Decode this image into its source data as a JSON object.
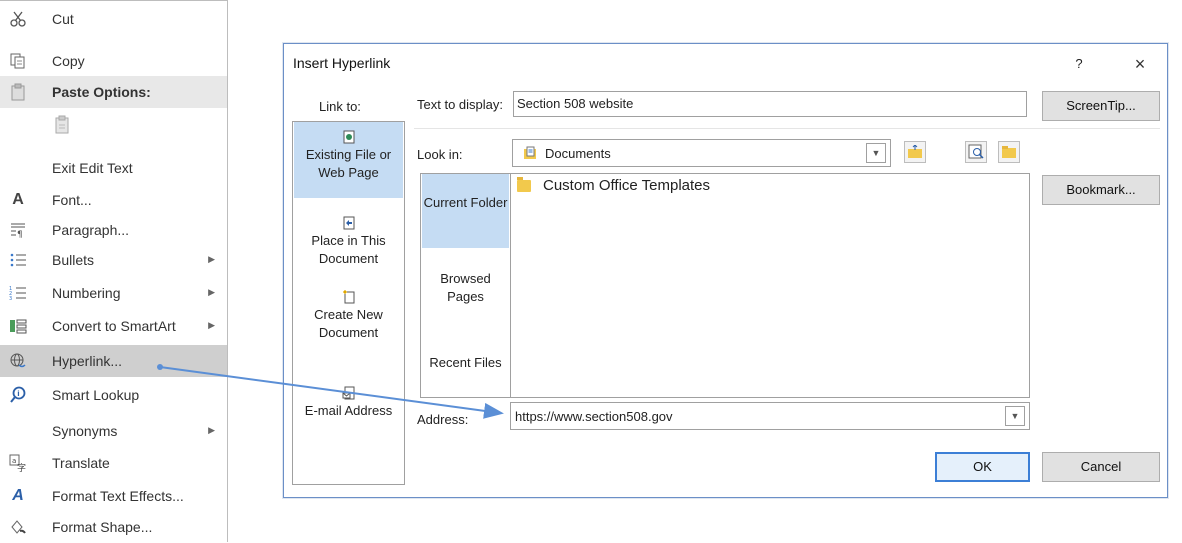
{
  "context_menu": {
    "cut": "Cut",
    "copy": "Copy",
    "paste_options": "Paste Options:",
    "exit_edit_text": "Exit Edit Text",
    "font": "Font...",
    "paragraph": "Paragraph...",
    "bullets": "Bullets",
    "numbering": "Numbering",
    "convert_smartart": "Convert to SmartArt",
    "hyperlink": "Hyperlink...",
    "smart_lookup": "Smart Lookup",
    "synonyms": "Synonyms",
    "translate": "Translate",
    "format_text_effects": "Format Text Effects...",
    "format_shape": "Format Shape..."
  },
  "dialog": {
    "title": "Insert Hyperlink",
    "help": "?",
    "close": "×",
    "link_to_label": "Link to:",
    "link_to_items": {
      "existing": "Existing File or Web Page",
      "place": "Place in This Document",
      "create_new": "Create New Document",
      "email": "E-mail Address"
    },
    "text_to_display_label": "Text to display:",
    "text_to_display_value": "Section 508 website",
    "screentip_button": "ScreenTip...",
    "look_in_label": "Look in:",
    "look_in_value": "Documents",
    "nav_items": {
      "current_folder": "Current Folder",
      "browsed_pages": "Browsed Pages",
      "recent_files": "Recent Files"
    },
    "files": [
      "Custom Office Templates"
    ],
    "bookmark_button": "Bookmark...",
    "address_label": "Address:",
    "address_value": "https://www.section508.gov",
    "ok_button": "OK",
    "cancel_button": "Cancel"
  },
  "colors": {
    "accent": "#3c7fd6",
    "selection": "#c5dcf3",
    "arrow": "#5b8fd6"
  }
}
